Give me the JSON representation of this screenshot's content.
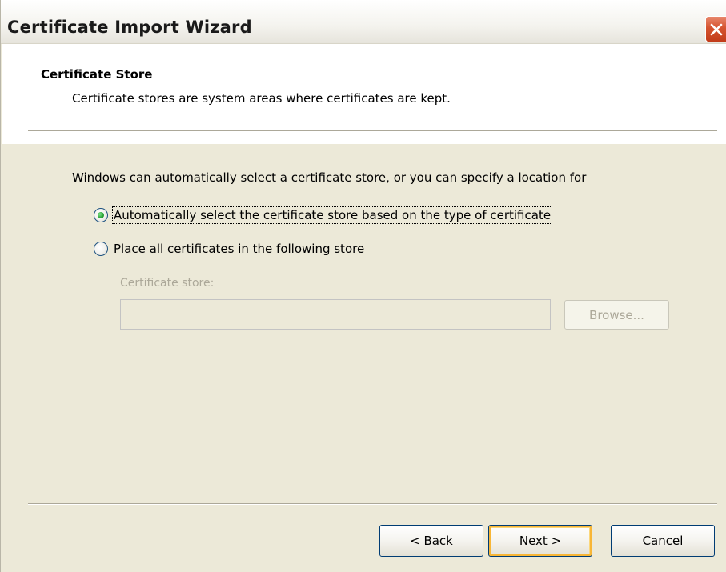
{
  "window": {
    "title": "Certificate Import Wizard",
    "close_icon": "close-icon"
  },
  "header": {
    "title": "Certificate Store",
    "description": "Certificate stores are system areas where certificates are kept."
  },
  "body": {
    "intro": "Windows can automatically select a certificate store, or you can specify a location for",
    "options": [
      {
        "label": "Automatically select the certificate store based on the type of certificate",
        "selected": true
      },
      {
        "label": "Place all certificates in the following store",
        "selected": false
      }
    ],
    "store_field": {
      "label": "Certificate store:",
      "value": ""
    },
    "browse_label": "Browse..."
  },
  "footer": {
    "back_label": "< Back",
    "next_label": "Next >",
    "cancel_label": "Cancel"
  },
  "colors": {
    "titlebar_bg": "#f4f3ee",
    "dialog_bg": "#ece9d8",
    "close_button": "#d5532f",
    "radio_selected": "#27a233",
    "disabled_text": "#aca899",
    "default_button_highlight": "#f8b636"
  }
}
